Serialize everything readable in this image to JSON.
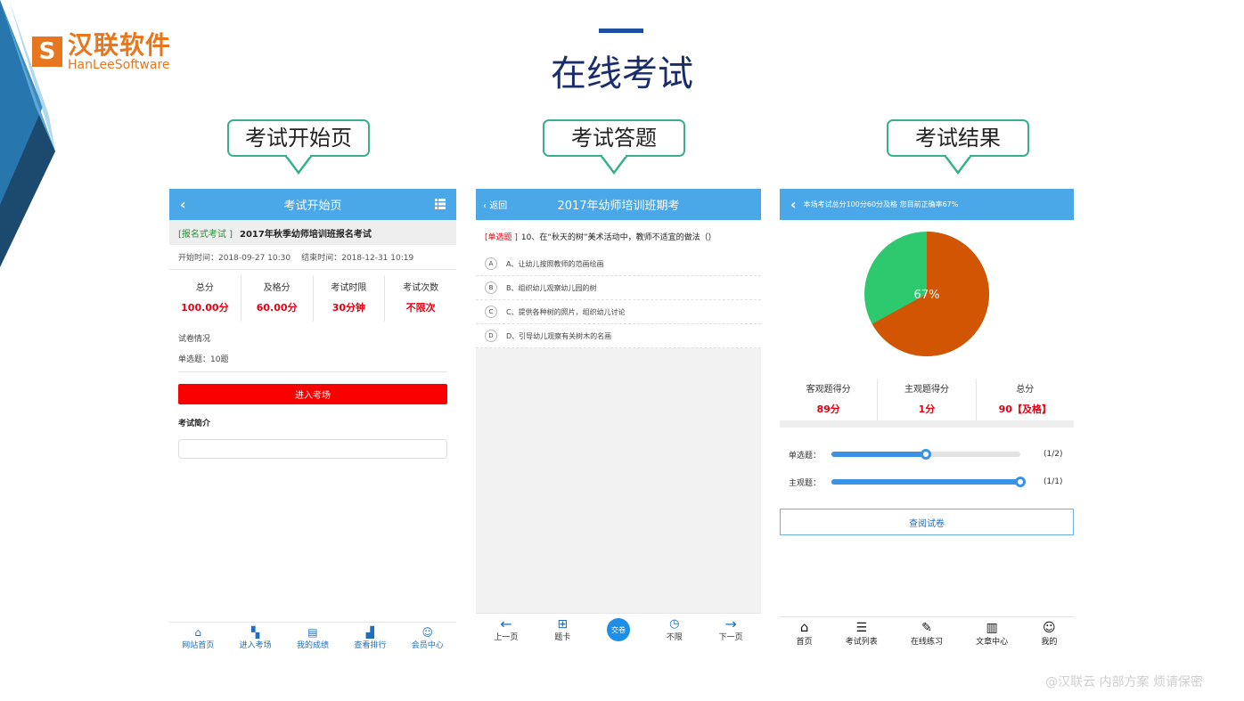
{
  "logo": {
    "cn": "汉联软件",
    "en": "HanLeeSoftware",
    "mark": "S"
  },
  "title": "在线考试",
  "callouts": [
    "考试开始页",
    "考试答题",
    "考试结果"
  ],
  "screen1": {
    "header": "考试开始页",
    "exam_tag": "[报名式考试 ]",
    "exam_name": "2017年秋季幼师培训班报名考试",
    "start": "开始时间：2018-09-27 10:30",
    "end": "结束时间：2018-12-31 10:19",
    "stats": [
      {
        "label": "总分",
        "value": "100.00分"
      },
      {
        "label": "及格分",
        "value": "60.00分"
      },
      {
        "label": "考试时限",
        "value": "30分钟"
      },
      {
        "label": "考试次数",
        "value": "不限次"
      }
    ],
    "paper_title": "试卷情况",
    "paper_detail": "单选题：10题",
    "enter_btn": "进入考场",
    "intro_title": "考试简介",
    "nav": [
      "网站首页",
      "进入考场",
      "我的成绩",
      "查看排行",
      "会员中心"
    ]
  },
  "screen2": {
    "back": "返回",
    "header": "2017年幼师培训班期考",
    "q_type": "[单选题 ]",
    "question": "10、在“秋天的树”美术活动中，教师不适宜的做法（）",
    "options": [
      {
        "letter": "A",
        "text": "A、让幼儿按照教师的范画绘画"
      },
      {
        "letter": "B",
        "text": "B、组织幼儿观察幼儿园的树"
      },
      {
        "letter": "C",
        "text": "C、提供各种树的照片，组织幼儿讨论"
      },
      {
        "letter": "D",
        "text": "D、引导幼儿观察有关树木的名画"
      }
    ],
    "nav": [
      "上一页",
      "题卡",
      "交卷",
      "不限",
      "下一页"
    ]
  },
  "screen3": {
    "header": "本场考试总分100分60分及格 您目前正确率67%",
    "pie_label": "67%",
    "pie_percent": 67,
    "colors": {
      "correct": "#d15502",
      "wrong": "#2ec86e"
    },
    "scores": [
      {
        "label": "客观题得分",
        "value": "89分"
      },
      {
        "label": "主观题得分",
        "value": "1分"
      },
      {
        "label": "总分",
        "value": "90【及格】"
      }
    ],
    "progress": [
      {
        "label": "单选题：",
        "ratio": "(1/2)",
        "fraction": 0.5
      },
      {
        "label": "主观题：",
        "ratio": "(1/1)",
        "fraction": 1.0
      }
    ],
    "review_btn": "查阅试卷",
    "nav": [
      "首页",
      "考试列表",
      "在线练习",
      "文章中心",
      "我的"
    ]
  },
  "watermark": "@汉联云 内部方案 烦请保密"
}
